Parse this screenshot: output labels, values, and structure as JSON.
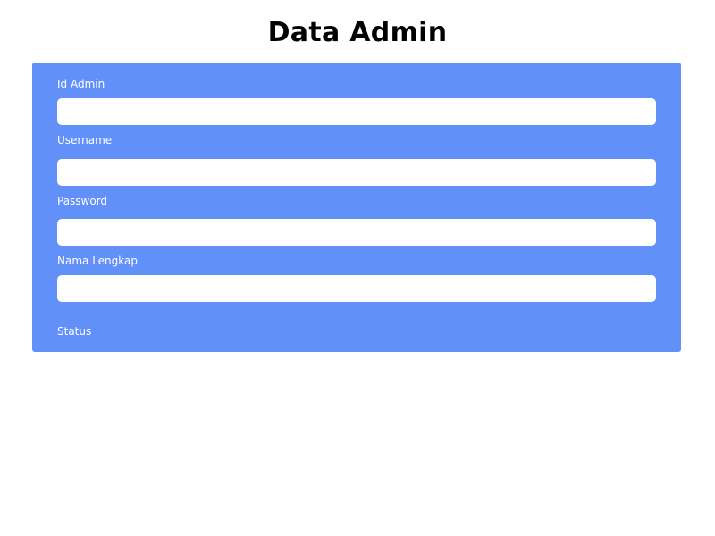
{
  "page": {
    "title": "Data Admin"
  },
  "form": {
    "id_admin": {
      "label": "Id Admin",
      "value": "",
      "placeholder": ""
    },
    "username": {
      "label": "Username",
      "value": "",
      "placeholder": ""
    },
    "password": {
      "label": "Password",
      "value": "",
      "placeholder": ""
    },
    "nama_lengkap": {
      "label": "Nama Lengkap",
      "value": "",
      "placeholder": ""
    },
    "status": {
      "label": "Status"
    }
  },
  "colors": {
    "panel_background": "#6190f9",
    "label_text": "#ffffff",
    "input_background": "#ffffff",
    "title_text": "#000000"
  }
}
